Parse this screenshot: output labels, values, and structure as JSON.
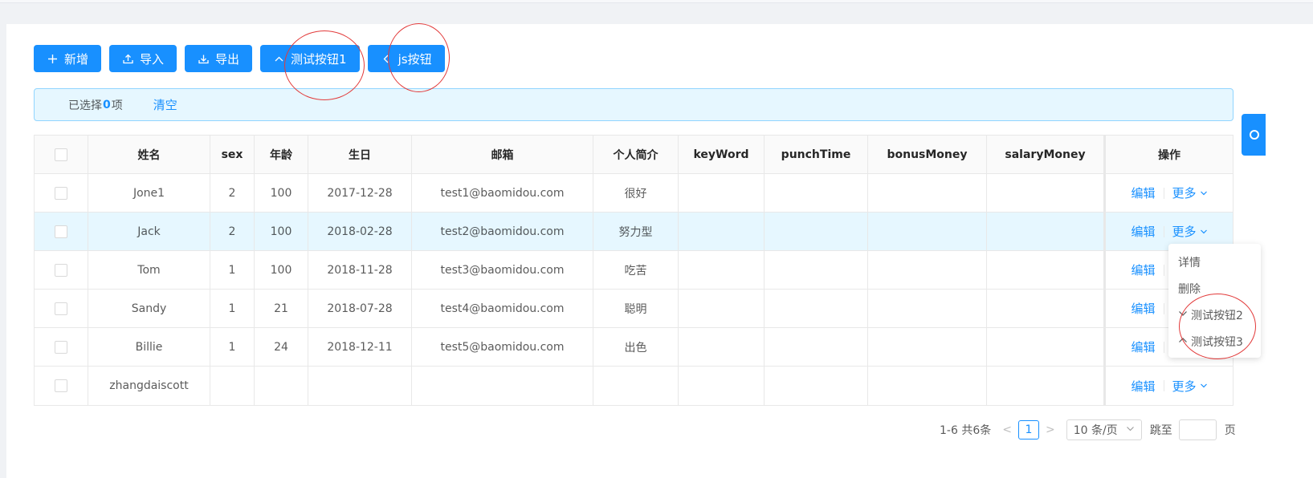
{
  "toolbar": {
    "buttons": [
      {
        "label": "新增",
        "icon": "plus-icon"
      },
      {
        "label": "导入",
        "icon": "upload-icon"
      },
      {
        "label": "导出",
        "icon": "download-icon"
      },
      {
        "label": "测试按钮1",
        "icon": "chevron-up-icon"
      },
      {
        "label": "js按钮",
        "icon": "chevron-left-icon"
      }
    ]
  },
  "selection": {
    "prefix": "已选择",
    "count": "0",
    "suffix": "项",
    "clear": "清空"
  },
  "table": {
    "columns": [
      "姓名",
      "sex",
      "年龄",
      "生日",
      "邮箱",
      "个人简介",
      "keyWord",
      "punchTime",
      "bonusMoney",
      "salaryMoney",
      "操作"
    ],
    "rows": [
      {
        "name": "Jone1",
        "sex": "2",
        "age": "100",
        "birthday": "2017-12-28",
        "email": "test1@baomidou.com",
        "intro": "很好"
      },
      {
        "name": "Jack",
        "sex": "2",
        "age": "100",
        "birthday": "2018-02-28",
        "email": "test2@baomidou.com",
        "intro": "努力型"
      },
      {
        "name": "Tom",
        "sex": "1",
        "age": "100",
        "birthday": "2018-11-28",
        "email": "test3@baomidou.com",
        "intro": "吃苦"
      },
      {
        "name": "Sandy",
        "sex": "1",
        "age": "21",
        "birthday": "2018-07-28",
        "email": "test4@baomidou.com",
        "intro": "聪明"
      },
      {
        "name": "Billie",
        "sex": "1",
        "age": "24",
        "birthday": "2018-12-11",
        "email": "test5@baomidou.com",
        "intro": "出色"
      },
      {
        "name": "zhangdaiscott",
        "sex": "",
        "age": "",
        "birthday": "",
        "email": "",
        "intro": ""
      }
    ],
    "actions": {
      "edit": "编辑",
      "more": "更多"
    }
  },
  "dropdown": {
    "items": [
      {
        "label": "详情",
        "icon": ""
      },
      {
        "label": "删除",
        "icon": ""
      },
      {
        "label": "测试按钮2",
        "icon": "chevron-down-icon"
      },
      {
        "label": "测试按钮3",
        "icon": "chevron-up-icon"
      }
    ]
  },
  "pagination": {
    "summary": "1-6 共6条",
    "current": "1",
    "page_size": "10 条/页",
    "jump_label": "跳至",
    "page_unit": "页"
  },
  "colors": {
    "primary": "#1890ff",
    "annotation": "#e23a3a",
    "row_highlight": "#e6f7ff"
  }
}
